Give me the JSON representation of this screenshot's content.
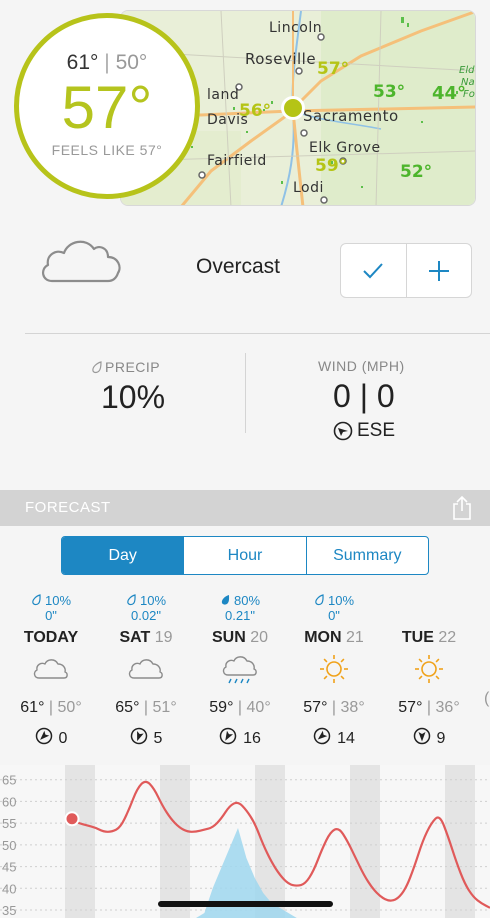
{
  "current": {
    "high": "61°",
    "separator": "|",
    "low": "50°",
    "now": "57°",
    "feels_like": "FEELS LIKE 57°"
  },
  "map": {
    "cities": [
      "Lincoln",
      "Roseville",
      "land",
      "Davis",
      "Sacramento",
      "Elk Grove",
      "Fairfield",
      "Lodi",
      "Eld",
      "Nat",
      "Fo"
    ],
    "temps": [
      "57°",
      "53°",
      "44°",
      "56°",
      "59°",
      "52°"
    ]
  },
  "condition": {
    "label": "Overcast",
    "icon": "cloud-icon"
  },
  "actions": {
    "check_icon": "checkmark-icon",
    "add_icon": "plus-icon"
  },
  "precip": {
    "label": "PRECIP",
    "value": "10%"
  },
  "wind": {
    "label": "WIND (MPH)",
    "value": "0 | 0",
    "direction": "ESE"
  },
  "forecast": {
    "title": "FORECAST",
    "tabs": [
      "Day",
      "Hour",
      "Summary"
    ],
    "active_tab": "Day",
    "days": [
      {
        "precip": "10%",
        "amount": "0\"",
        "name": "TODAY",
        "num": "",
        "icon": "cloud-icon",
        "high": "61°",
        "low": "50°",
        "wind": "0"
      },
      {
        "precip": "10%",
        "amount": "0.02\"",
        "name": "SAT",
        "num": "19",
        "icon": "cloud-icon",
        "high": "65°",
        "low": "51°",
        "wind": "5"
      },
      {
        "precip": "80%",
        "amount": "0.21\"",
        "name": "SUN",
        "num": "20",
        "icon": "rain-cloud-icon",
        "high": "59°",
        "low": "40°",
        "wind": "16"
      },
      {
        "precip": "10%",
        "amount": "0\"",
        "name": "MON",
        "num": "21",
        "icon": "sun-icon",
        "high": "57°",
        "low": "38°",
        "wind": "14"
      },
      {
        "precip": "",
        "amount": "",
        "name": "TUE",
        "num": "22",
        "icon": "sun-icon",
        "high": "57°",
        "low": "36°",
        "wind": "9"
      }
    ]
  },
  "chart_data": {
    "type": "line",
    "y_ticks": [
      "65",
      "60",
      "55",
      "50",
      "45",
      "40",
      "35"
    ],
    "ylim": [
      35,
      67
    ],
    "temperature": [
      56,
      55,
      54.5,
      54,
      53,
      53,
      54,
      58,
      63,
      65,
      63,
      59,
      56,
      54,
      53,
      53,
      53.5,
      54,
      56,
      59,
      60,
      58,
      55,
      50,
      46,
      43,
      41,
      40.5,
      41,
      44,
      49,
      53,
      54,
      51,
      47,
      43,
      40,
      38,
      37,
      37.5,
      40,
      45,
      51,
      55,
      57,
      52,
      46,
      41,
      38,
      36.5,
      35.5
    ],
    "precip_shading": [
      0,
      0,
      0,
      0,
      0,
      0,
      0,
      0,
      0,
      0,
      0,
      0,
      0,
      0,
      0,
      0,
      0.05,
      0.3,
      0.5,
      0.7,
      0.9,
      0.6,
      0.4,
      0.25,
      0.15,
      0.1,
      0.05,
      0,
      0,
      0,
      0,
      0,
      0,
      0,
      0,
      0,
      0,
      0,
      0,
      0,
      0,
      0,
      0,
      0,
      0,
      0,
      0,
      0,
      0,
      0,
      0
    ],
    "marker_value": 56,
    "colors": {
      "line": "#e05a5a",
      "precip": "#9fd7ee",
      "band": "#e4e4e4"
    }
  }
}
